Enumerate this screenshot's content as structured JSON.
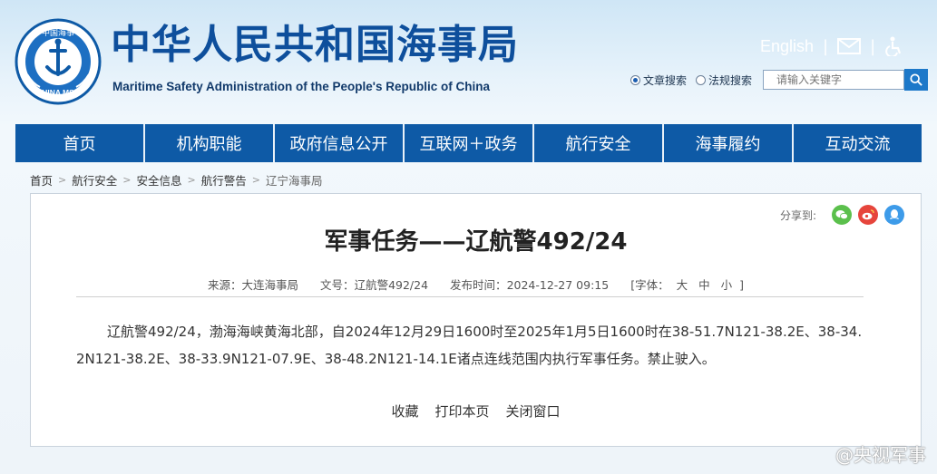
{
  "header": {
    "title_cn": "中华人民共和国海事局",
    "title_en": "Maritime Safety Administration of the People's Republic of China",
    "emblem_text_top": "中国海事",
    "emblem_text_bottom": "CHINA MSA",
    "english_link": "English",
    "mail_icon": "mail-icon",
    "accessibility_icon": "accessibility-icon"
  },
  "search": {
    "option_articles": "文章搜索",
    "option_regulations": "法规搜索",
    "selected": "文章搜索",
    "placeholder": "请输入关键字",
    "button_icon": "search-icon"
  },
  "nav": {
    "items": [
      "首页",
      "机构职能",
      "政府信息公开",
      "互联网＋政务",
      "航行安全",
      "海事履约",
      "互动交流"
    ]
  },
  "breadcrumb": {
    "items": [
      "首页",
      "航行安全",
      "安全信息",
      "航行警告",
      "辽宁海事局"
    ]
  },
  "article": {
    "share_label": "分享到:",
    "share_icons": [
      "wechat-icon",
      "weibo-icon",
      "qq-icon"
    ],
    "title": "军事任务——辽航警492/24",
    "source_label": "来源：",
    "source": "大连海事局",
    "doc_no_label": "文号：",
    "doc_no": "辽航警492/24",
    "publish_label": "发布时间：",
    "publish_time": "2024-12-27 09:15",
    "font_label": "[字体：",
    "font_large": "大",
    "font_medium": "中",
    "font_small": "小",
    "font_close": "]",
    "body": "辽航警492/24，渤海海峡黄海北部，自2024年12月29日1600时至2025年1月5日1600时在38-51.7N121-38.2E、38-34.2N121-38.2E、38-33.9N121-07.9E、38-48.2N121-14.1E诸点连线范围内执行军事任务。禁止驶入。",
    "actions": [
      "收藏",
      "打印本页",
      "关闭窗口"
    ]
  },
  "watermark": "@央视军事",
  "colors": {
    "brand_blue": "#0e5aa6",
    "title_blue": "#0e4f9c",
    "wechat": "#5bc04c",
    "weibo": "#e6453c",
    "qq": "#3d9be9"
  }
}
